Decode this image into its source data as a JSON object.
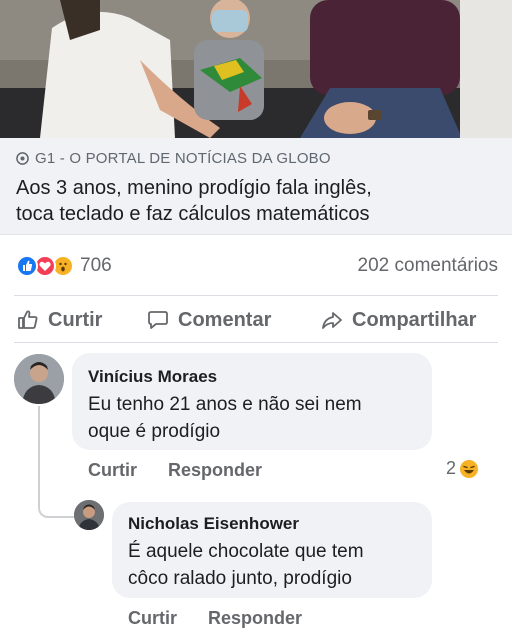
{
  "post": {
    "source": "G1 - O PORTAL DE NOTÍCIAS DA GLOBO",
    "headline_line1": "Aos 3 anos, menino prodígio fala inglês,",
    "headline_line2": "toca teclado e faz cálculos matemáticos",
    "reaction_count": "706",
    "comment_count": "202 comentários",
    "reactions": [
      "like-icon",
      "love-icon",
      "wow-icon"
    ]
  },
  "actions": {
    "like": "Curtir",
    "comment": "Comentar",
    "share": "Compartilhar"
  },
  "comments": [
    {
      "author": "Vinícius Moraes",
      "text_line1": "Eu tenho 21 anos e não sei nem",
      "text_line2": "oque é prodígio",
      "like": "Curtir",
      "reply": "Responder",
      "reaction_count": "2",
      "reaction_icon": "laugh-icon"
    },
    {
      "author": "Nicholas Eisenhower",
      "text_line1": "É aquele chocolate que tem",
      "text_line2": "côco ralado junto, prodígio",
      "like": "Curtir",
      "reply": "Responder"
    }
  ],
  "colors": {
    "accent": "#1877f2",
    "love": "#f33e58",
    "wow": "#f7b125",
    "secondary_text": "#65676b",
    "bubble": "#f0f2f5"
  }
}
